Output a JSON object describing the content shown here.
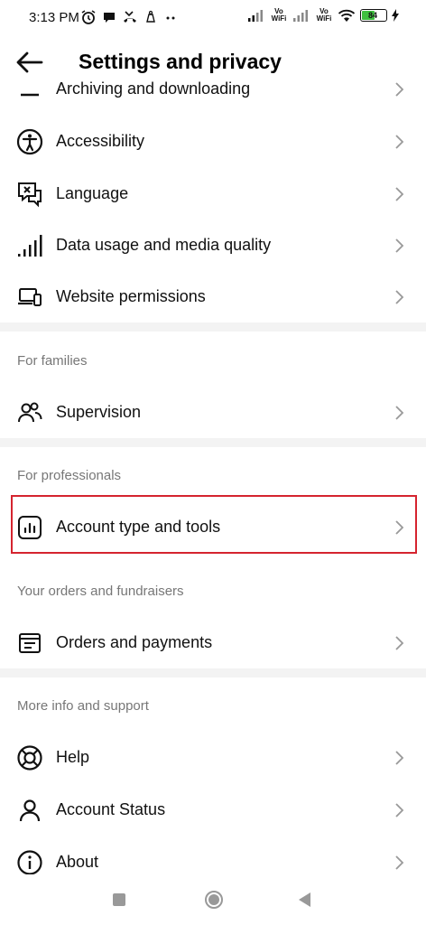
{
  "status_bar": {
    "time": "3:13 PM",
    "vowifi_1": "Vo WiFi",
    "vowifi_2": "Vo WiFi",
    "battery_level": "84"
  },
  "header": {
    "title": "Settings and privacy"
  },
  "rows": {
    "archiving": {
      "label": "Archiving and downloading",
      "icon": "archive-icon"
    },
    "accessibility": {
      "label": "Accessibility",
      "icon": "accessibility-icon"
    },
    "language": {
      "label": "Language",
      "icon": "language-icon"
    },
    "data_usage": {
      "label": "Data usage and media quality",
      "icon": "signal-bars-icon"
    },
    "website_permissions": {
      "label": "Website permissions",
      "icon": "devices-icon"
    },
    "supervision": {
      "label": "Supervision",
      "icon": "people-icon"
    },
    "account_type": {
      "label": "Account type and tools",
      "icon": "chart-icon"
    },
    "orders": {
      "label": "Orders and payments",
      "icon": "receipt-icon"
    },
    "help": {
      "label": "Help",
      "icon": "lifebuoy-icon"
    },
    "account_status": {
      "label": "Account Status",
      "icon": "person-icon"
    },
    "about": {
      "label": "About",
      "icon": "info-icon"
    }
  },
  "sections": {
    "families": "For families",
    "professionals": "For professionals",
    "orders_fundraisers": "Your orders and fundraisers",
    "more_info": "More info and support"
  },
  "colors": {
    "highlight_border": "#d5242f",
    "section_title": "#777777",
    "divider": "#f3f3f3",
    "battery_fill": "#3fbf3f"
  }
}
